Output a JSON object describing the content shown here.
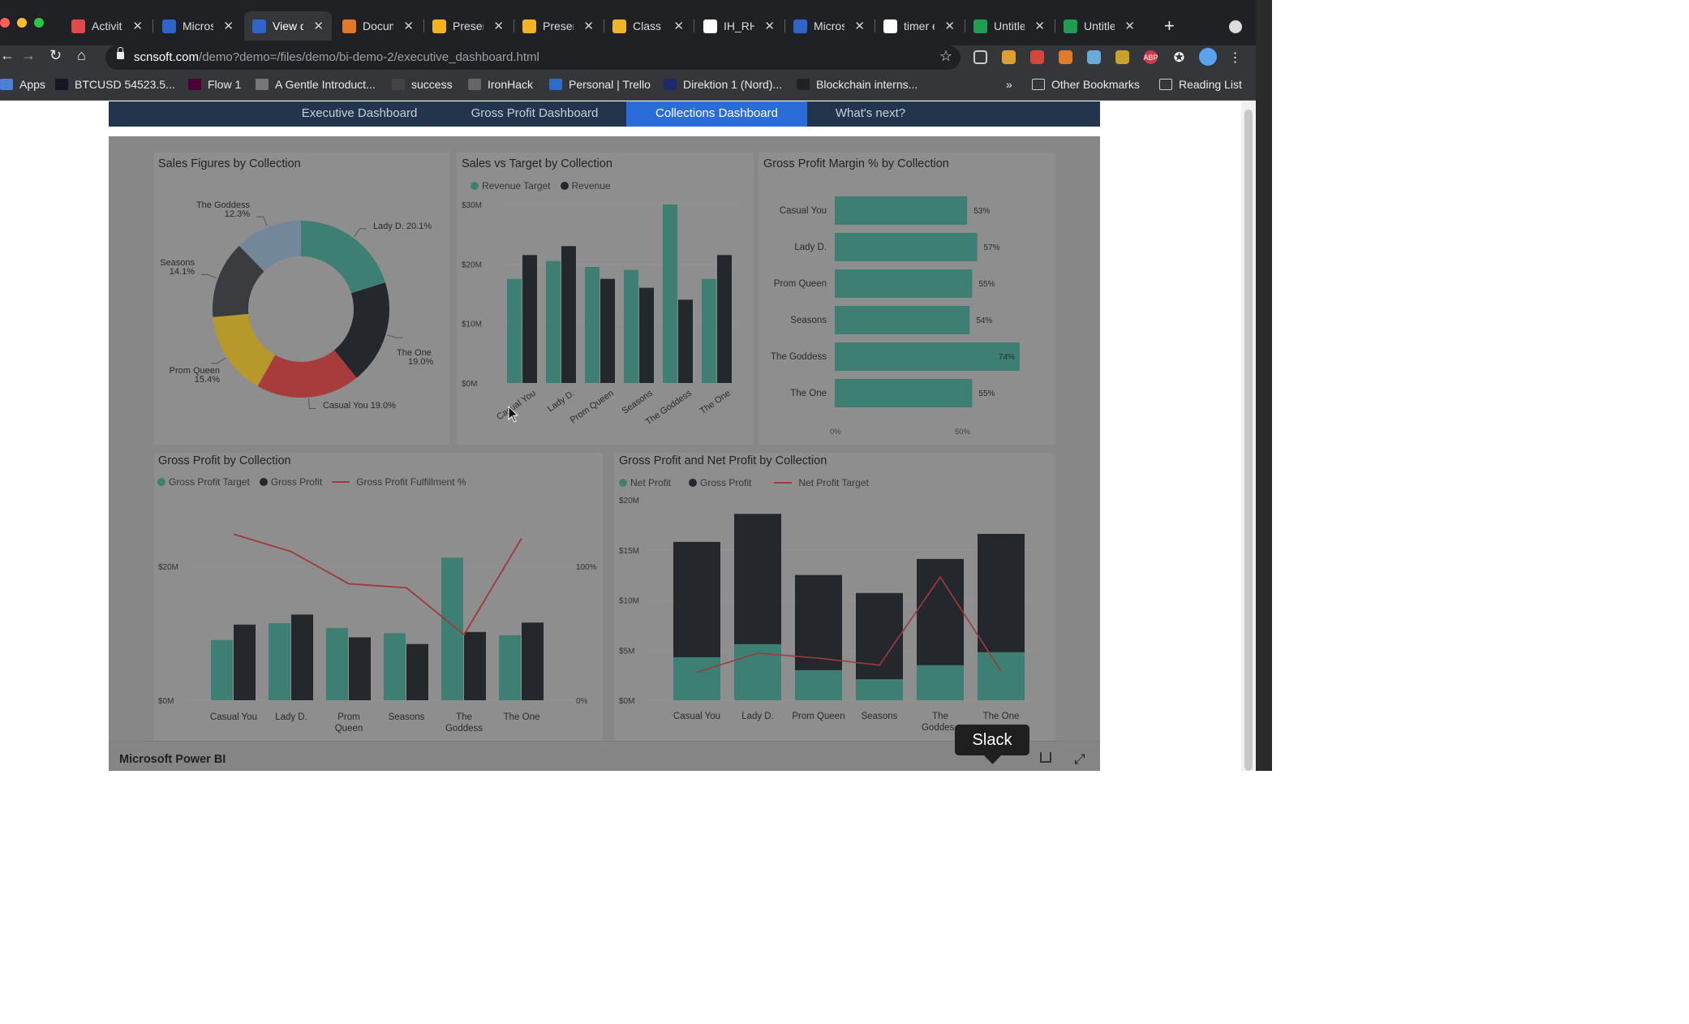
{
  "browser": {
    "tabs": [
      {
        "title": "Activit",
        "icon": "trello-icon",
        "color": "#e04a4a"
      },
      {
        "title": "Micros",
        "icon": "doc-icon",
        "color": "#2f64c8"
      },
      {
        "title": "View d",
        "icon": "doc-icon",
        "color": "#2f64c8",
        "active": true
      },
      {
        "title": "Docum",
        "icon": "loading-icon",
        "color": "#e07a2a"
      },
      {
        "title": "Preser",
        "icon": "slides-icon",
        "color": "#f2b320"
      },
      {
        "title": "Preser",
        "icon": "slides-icon",
        "color": "#f2b320"
      },
      {
        "title": "Class \\",
        "icon": "hand-icon",
        "color": "#f0b429"
      },
      {
        "title": "IH_RH",
        "icon": "github-icon",
        "color": "#ffffff"
      },
      {
        "title": "Micros",
        "icon": "doc-icon",
        "color": "#2f64c8"
      },
      {
        "title": "timer é",
        "icon": "google-icon",
        "color": "#ffffff"
      },
      {
        "title": "Untitle",
        "icon": "sheets-icon",
        "color": "#1f9d55"
      },
      {
        "title": "Untitle",
        "icon": "sheets-icon",
        "color": "#1f9d55"
      }
    ],
    "new_tab_label": "+",
    "url_domain": "scnsoft.com",
    "url_path": "/demo?demo=/files/demo/bi-demo-2/executive_dashboard.html",
    "bookmarks": [
      {
        "label": "Apps"
      },
      {
        "label": "BTCUSD 54523.5..."
      },
      {
        "label": "Flow 1"
      },
      {
        "label": "A Gentle Introduct..."
      },
      {
        "label": "success"
      },
      {
        "label": "IronHack"
      },
      {
        "label": "Personal | Trello"
      },
      {
        "label": "Direktion 1 (Nord)..."
      },
      {
        "label": "Blockchain interns..."
      }
    ],
    "bookmarks_overflow": "»",
    "other_bookmarks": "Other Bookmarks",
    "reading_list": "Reading List"
  },
  "nav_tabs": [
    {
      "label": "Executive Dashboard",
      "active": false
    },
    {
      "label": "Gross Profit Dashboard",
      "active": false
    },
    {
      "label": "Collections Dashboard",
      "active": true
    },
    {
      "label": "What's next?",
      "active": false
    }
  ],
  "colors": {
    "teal": "#3d8073",
    "dark": "#24282d",
    "red": "#a03a3a",
    "navy": "#22354d",
    "active_tab": "#2a6dd9"
  },
  "panels": {
    "donut": {
      "title": "Sales Figures by Collection"
    },
    "sales_vs_target": {
      "title": "Sales vs Target by Collection",
      "legend": [
        "Revenue Target",
        "Revenue"
      ]
    },
    "gpm": {
      "title": "Gross Profit Margin % by Collection"
    },
    "gross_profit": {
      "title": "Gross Profit by Collection",
      "legend": [
        "Gross Profit Target",
        "Gross Profit",
        "Gross Profit Fulfillment %"
      ]
    },
    "gp_np": {
      "title": "Gross Profit and Net Profit by Collection",
      "legend": [
        "Net Profit",
        "Gross Profit",
        "Net Profit Target"
      ]
    }
  },
  "chart_data": [
    {
      "type": "pie",
      "title": "Sales Figures by Collection",
      "categories": [
        "Lady D.",
        "The One",
        "Casual You",
        "Prom Queen",
        "Seasons",
        "The Goddess"
      ],
      "values": [
        20.1,
        19.0,
        19.0,
        15.4,
        14.1,
        12.3
      ],
      "labels": [
        "Lady D. 20.1%",
        "The One 19.0%",
        "Casual You 19.0%",
        "Prom Queen 15.4%",
        "Seasons 14.1%",
        "The Goddess 12.3%"
      ],
      "colors": [
        "#3d8073",
        "#24282d",
        "#a83b3b",
        "#b7982a",
        "#3a3c40",
        "#72879a"
      ]
    },
    {
      "type": "bar",
      "title": "Sales vs Target by Collection",
      "categories": [
        "Casual You",
        "Lady D.",
        "Prom Queen",
        "Seasons",
        "The Goddess",
        "The One"
      ],
      "series": [
        {
          "name": "Revenue Target",
          "values": [
            17.5,
            20.5,
            19.5,
            19,
            30,
            17.5
          ]
        },
        {
          "name": "Revenue",
          "values": [
            21.5,
            23,
            17.5,
            16,
            14,
            21.5
          ]
        }
      ],
      "yticks": [
        "$0M",
        "$10M",
        "$20M",
        "$30M"
      ],
      "ylim": [
        0,
        30
      ]
    },
    {
      "type": "bar",
      "title": "Gross Profit Margin % by Collection",
      "categories": [
        "Casual You",
        "Lady D.",
        "Prom Queen",
        "Seasons",
        "The Goddess",
        "The One"
      ],
      "values": [
        53,
        57,
        55,
        54,
        74,
        55
      ],
      "value_labels": [
        "53%",
        "57%",
        "55%",
        "54%",
        "74%",
        "55%"
      ],
      "xticks": [
        "0%",
        "50%"
      ],
      "xlim": [
        0,
        100
      ]
    },
    {
      "type": "bar",
      "title": "Gross Profit by Collection",
      "categories": [
        "Casual You",
        "Lady D.",
        "Prom Queen",
        "Seasons",
        "The Goddess",
        "The One"
      ],
      "category_labels": [
        [
          "Casual You"
        ],
        [
          "Lady D."
        ],
        [
          "Prom",
          "Queen"
        ],
        [
          "Seasons"
        ],
        [
          "The",
          "Goddess"
        ],
        [
          "The One"
        ]
      ],
      "series": [
        {
          "name": "Gross Profit Target",
          "values": [
            9,
            11.5,
            10.8,
            10,
            21.3,
            9.7
          ]
        },
        {
          "name": "Gross Profit",
          "values": [
            11.3,
            12.8,
            9.4,
            8.4,
            10.2,
            11.6
          ]
        },
        {
          "name": "Gross Profit Fulfillment %",
          "axis": "right",
          "values": [
            124,
            111,
            87,
            84,
            49,
            121
          ]
        }
      ],
      "yticks": [
        "$0M",
        "$20M"
      ],
      "ylim": [
        0,
        20
      ],
      "y2ticks": [
        "0%",
        "100%"
      ],
      "y2lim": [
        0,
        100
      ]
    },
    {
      "type": "bar",
      "title": "Gross Profit and Net Profit by Collection",
      "categories": [
        "Casual You",
        "Lady D.",
        "Prom Queen",
        "Seasons",
        "The Goddess",
        "The One"
      ],
      "category_labels": [
        [
          "Casual You"
        ],
        [
          "Lady D."
        ],
        [
          "Prom Queen"
        ],
        [
          "Seasons"
        ],
        [
          "The",
          "Goddess"
        ],
        [
          "The One"
        ]
      ],
      "series": [
        {
          "name": "Net Profit",
          "values": [
            4.3,
            5.6,
            3,
            2.1,
            3.5,
            4.8
          ]
        },
        {
          "name": "Gross Profit",
          "values": [
            15.8,
            18.6,
            12.5,
            10.7,
            14.1,
            16.6
          ]
        },
        {
          "name": "Net Profit Target",
          "values": [
            2.8,
            4.7,
            4.2,
            3.5,
            12.3,
            2.9
          ]
        }
      ],
      "yticks": [
        "$0M",
        "$5M",
        "$10M",
        "$15M",
        "$20M"
      ],
      "ylim": [
        0,
        20
      ]
    }
  ],
  "footer": {
    "brand": "Microsoft Power BI"
  },
  "tooltip": {
    "text": "Slack"
  }
}
